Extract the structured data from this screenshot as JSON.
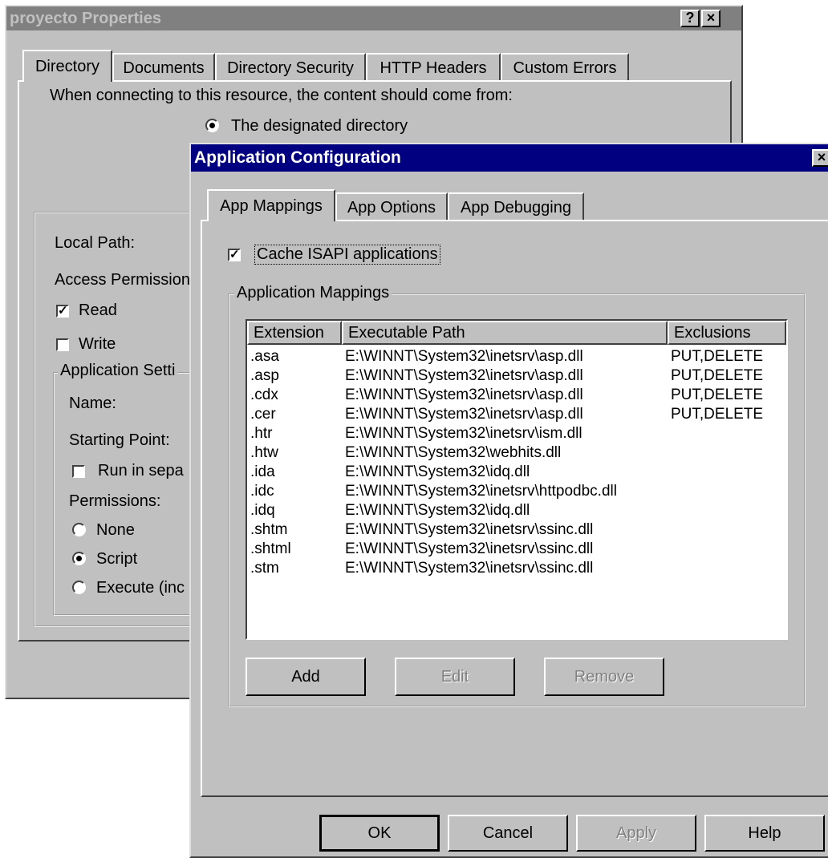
{
  "back_window": {
    "title": "proyecto Properties",
    "help_button": "?",
    "close_button": "×",
    "tabs": [
      "Directory",
      "Documents",
      "Directory Security",
      "HTTP Headers",
      "Custom Errors"
    ],
    "connect_label": "When connecting to this resource, the content should come from:",
    "option_designated": "The designated directory",
    "local_path_label": "Local Path:",
    "access_permissions_label": "Access Permission",
    "read_label": "Read",
    "write_label": "Write",
    "app_settings_label": "Application Setti",
    "name_label": "Name:",
    "starting_point_label": "Starting Point:",
    "run_in_separate_label": "Run in sepa",
    "permissions_label": "Permissions:",
    "perm_none": "None",
    "perm_script": "Script",
    "perm_execute": "Execute (inc"
  },
  "dialog": {
    "title": "Application Configuration",
    "close_button": "×",
    "tabs": [
      "App Mappings",
      "App Options",
      "App Debugging"
    ],
    "cache_isapi_label": "Cache ISAPI applications",
    "group_title": "Application Mappings",
    "columns": [
      "Extension",
      "Executable Path",
      "Exclusions"
    ],
    "mappings": [
      {
        "ext": ".asa",
        "path": "E:\\WINNT\\System32\\inetsrv\\asp.dll",
        "excl": "PUT,DELETE"
      },
      {
        "ext": ".asp",
        "path": "E:\\WINNT\\System32\\inetsrv\\asp.dll",
        "excl": "PUT,DELETE"
      },
      {
        "ext": ".cdx",
        "path": "E:\\WINNT\\System32\\inetsrv\\asp.dll",
        "excl": "PUT,DELETE"
      },
      {
        "ext": ".cer",
        "path": "E:\\WINNT\\System32\\inetsrv\\asp.dll",
        "excl": "PUT,DELETE"
      },
      {
        "ext": ".htr",
        "path": "E:\\WINNT\\System32\\inetsrv\\ism.dll",
        "excl": ""
      },
      {
        "ext": ".htw",
        "path": "E:\\WINNT\\System32\\webhits.dll",
        "excl": ""
      },
      {
        "ext": ".ida",
        "path": "E:\\WINNT\\System32\\idq.dll",
        "excl": ""
      },
      {
        "ext": ".idc",
        "path": "E:\\WINNT\\System32\\inetsrv\\httpodbc.dll",
        "excl": ""
      },
      {
        "ext": ".idq",
        "path": "E:\\WINNT\\System32\\idq.dll",
        "excl": ""
      },
      {
        "ext": ".shtm",
        "path": "E:\\WINNT\\System32\\inetsrv\\ssinc.dll",
        "excl": ""
      },
      {
        "ext": ".shtml",
        "path": "E:\\WINNT\\System32\\inetsrv\\ssinc.dll",
        "excl": ""
      },
      {
        "ext": ".stm",
        "path": "E:\\WINNT\\System32\\inetsrv\\ssinc.dll",
        "excl": ""
      }
    ],
    "add_button": "Add",
    "edit_button": "Edit",
    "remove_button": "Remove",
    "ok_button": "OK",
    "cancel_button": "Cancel",
    "apply_button": "Apply",
    "help_button": "Help"
  }
}
